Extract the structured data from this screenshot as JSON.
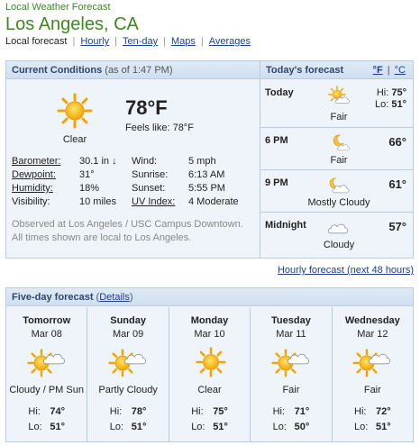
{
  "header": {
    "subtitle": "Local Weather Forecast",
    "location": "Los Angeles, CA"
  },
  "nav": {
    "current": "Local forecast",
    "links": [
      "Hourly",
      "Ten-day",
      "Maps",
      "Averages"
    ]
  },
  "current": {
    "title": "Current Conditions",
    "as_of": "(as of 1:47 PM)",
    "temp": "78°F",
    "feels_like": "Feels like: 78°F",
    "condition": "Clear",
    "icon": "sun-icon",
    "stats": {
      "barometer_label": "Barometer:",
      "barometer_value": "30.1 in ↓",
      "dewpoint_label": "Dewpoint:",
      "dewpoint_value": "31°",
      "humidity_label": "Humidity:",
      "humidity_value": "18%",
      "visibility_label": "Visibility:",
      "visibility_value": "10 miles",
      "wind_label": "Wind:",
      "wind_value": "5 mph",
      "sunrise_label": "Sunrise:",
      "sunrise_value": "6:13 AM",
      "sunset_label": "Sunset:",
      "sunset_value": "5:55 PM",
      "uv_label": "UV Index:",
      "uv_value": "4 Moderate"
    },
    "observed_line1": "Observed at Los Angeles / USC Campus Downtown.",
    "observed_line2": "All times shown are local to Los Angeles."
  },
  "today": {
    "title": "Today's forecast",
    "unit_f": "°F",
    "unit_sep": "|",
    "unit_c": "°C",
    "rows": [
      {
        "period": "Today",
        "condition": "Fair",
        "hi_label": "Hi:",
        "hi": "75°",
        "lo_label": "Lo:",
        "lo": "51°",
        "icon": "sun-partly-cloudy-icon"
      },
      {
        "period": "6 PM",
        "condition": "Fair",
        "temp": "66°",
        "icon": "moon-cloud-icon"
      },
      {
        "period": "9 PM",
        "condition": "Mostly Cloudy",
        "temp": "61°",
        "icon": "moon-mostly-cloudy-icon"
      },
      {
        "period": "Midnight",
        "condition": "Cloudy",
        "temp": "57°",
        "icon": "cloud-icon"
      }
    ]
  },
  "hourly_link": "Hourly forecast (next 48 hours)",
  "five_day": {
    "title": "Five-day forecast",
    "details": "Details",
    "days": [
      {
        "name": "Tomorrow",
        "date": "Mar 08",
        "condition": "Cloudy / PM Sun",
        "hi": "74°",
        "lo": "51°",
        "icon": "sun-cloud-icon"
      },
      {
        "name": "Sunday",
        "date": "Mar 09",
        "condition": "Partly Cloudy",
        "hi": "78°",
        "lo": "51°",
        "icon": "sun-cloud-icon"
      },
      {
        "name": "Monday",
        "date": "Mar 10",
        "condition": "Clear",
        "hi": "75°",
        "lo": "51°",
        "icon": "sun-icon"
      },
      {
        "name": "Tuesday",
        "date": "Mar 11",
        "condition": "Fair",
        "hi": "71°",
        "lo": "50°",
        "icon": "sun-cloud-icon"
      },
      {
        "name": "Wednesday",
        "date": "Mar 12",
        "condition": "Fair",
        "hi": "72°",
        "lo": "51°",
        "icon": "sun-cloud-icon"
      }
    ],
    "hi_label": "Hi:",
    "lo_label": "Lo:"
  },
  "colors": {
    "accent_green": "#3b8a1e",
    "link_blue": "#1b3f95",
    "panel_bg": "#eef4fa",
    "panel_border": "#b8cde2",
    "sun": "#f5b800"
  }
}
